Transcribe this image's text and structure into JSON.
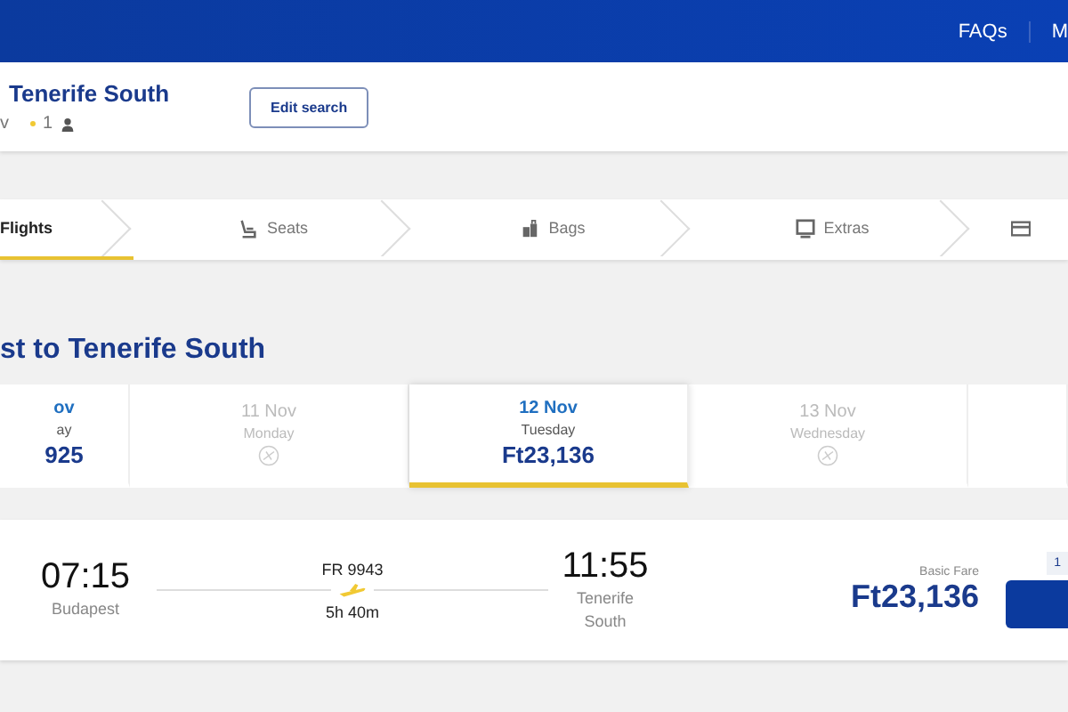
{
  "top_bar": {
    "links": [
      "FAQs",
      "M"
    ]
  },
  "search_summary": {
    "title": "Tenerife South",
    "date_fragment": "v",
    "passengers": "1",
    "edit_button": "Edit search"
  },
  "steps": [
    {
      "label": "Flights",
      "selected": true
    },
    {
      "label": "Seats",
      "selected": false
    },
    {
      "label": "Bags",
      "selected": false
    },
    {
      "label": "Extras",
      "selected": false
    },
    {
      "selected": false
    }
  ],
  "route_title": "st to Tenerife South",
  "dates": [
    {
      "date": "ov",
      "day": "ay",
      "price": "925",
      "available": true,
      "selected": false
    },
    {
      "date": "11 Nov",
      "day": "Monday",
      "available": false,
      "selected": false
    },
    {
      "date": "12 Nov",
      "day": "Tuesday",
      "price": "Ft23,136",
      "available": true,
      "selected": true
    },
    {
      "date": "13 Nov",
      "day": "Wednesday",
      "available": false,
      "selected": false
    },
    {
      "available": true,
      "selected": false
    }
  ],
  "flight": {
    "depart_time": "07:15",
    "depart_city": "Budapest",
    "flight_no": "FR 9943",
    "duration": "5h 40m",
    "arrive_time": "11:55",
    "arrive_city": "Tenerife South",
    "fare_label": "Basic Fare",
    "fare_price": "Ft23,136",
    "badge": "1"
  }
}
